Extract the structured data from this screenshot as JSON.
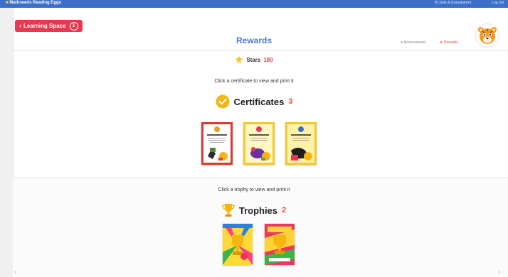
{
  "topbar": {
    "brand": "Mathseeds Reading Eggs",
    "user": "Hi Jade & Grandparent",
    "logout": "Log out"
  },
  "back_button": {
    "label": "Learning Space",
    "badge": "1"
  },
  "page": {
    "title": "Rewards",
    "links": {
      "achievements": "Achievements",
      "rewards": "Rewards"
    }
  },
  "stars": {
    "label": "Stars",
    "count": "180"
  },
  "certificates": {
    "instruction": "Click a certificate to view and print it",
    "title": "Certificates",
    "count": "3",
    "items": [
      {
        "name": "certificate-1",
        "border": "#d93a2e",
        "background": "#ffffff"
      },
      {
        "name": "certificate-2",
        "border": "#f4c92e",
        "background": "#fff7c2"
      },
      {
        "name": "certificate-3",
        "border": "#f4c92e",
        "background": "#fff2a8"
      }
    ]
  },
  "trophies": {
    "instruction": "Click a trophy to view and print it",
    "title": "Trophies",
    "count": "2",
    "items": [
      {
        "name": "trophy-1",
        "colors": [
          "#ff3f7f",
          "#ffd83a",
          "#2d7fe0"
        ]
      },
      {
        "name": "trophy-2",
        "colors": [
          "#e83a5e",
          "#ffd23a",
          "#3db34a"
        ]
      }
    ]
  },
  "colors": {
    "topbar": "#3d6fc9",
    "accent": "#e8384f",
    "title": "#4a78cf",
    "count": "#e84a3a"
  }
}
